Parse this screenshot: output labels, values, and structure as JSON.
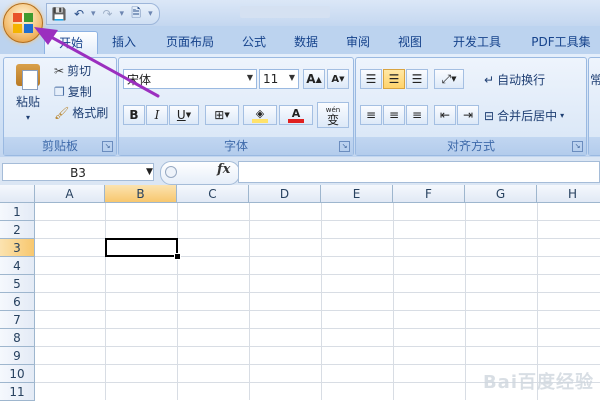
{
  "name_box": "B3",
  "fx_label": "fx",
  "tabs": [
    "开始",
    "插入",
    "页面布局",
    "公式",
    "数据",
    "审阅",
    "视图",
    "开发工具",
    "PDF工具集"
  ],
  "clipboard": {
    "paste": "粘贴",
    "cut": "剪切",
    "copy": "复制",
    "format_painter": "格式刷",
    "group_label": "剪贴板"
  },
  "font": {
    "font_name": "宋体",
    "font_size": "11",
    "grow": "A",
    "shrink": "A",
    "bold": "B",
    "italic": "I",
    "underline": "U",
    "color_letter": "A",
    "phonetic": "wén",
    "phonetic_char": "变",
    "group_label": "字体"
  },
  "alignment": {
    "wrap_text": "自动换行",
    "merge_center": "合并后居中",
    "group_label": "对齐方式"
  },
  "number": {
    "general_partial": "常"
  },
  "columns": [
    "A",
    "B",
    "C",
    "D",
    "E",
    "F",
    "G",
    "H"
  ],
  "rows": [
    "1",
    "2",
    "3",
    "4",
    "5",
    "6",
    "7",
    "8",
    "9",
    "10",
    "11"
  ],
  "selected_column": "B",
  "selected_row": "3",
  "watermark": "Bai百度经验",
  "colors": {
    "arrow": "#9b2fbf",
    "highlight": "#ffe26a",
    "font_color": "#e02020",
    "selection": "#f8c76e"
  }
}
